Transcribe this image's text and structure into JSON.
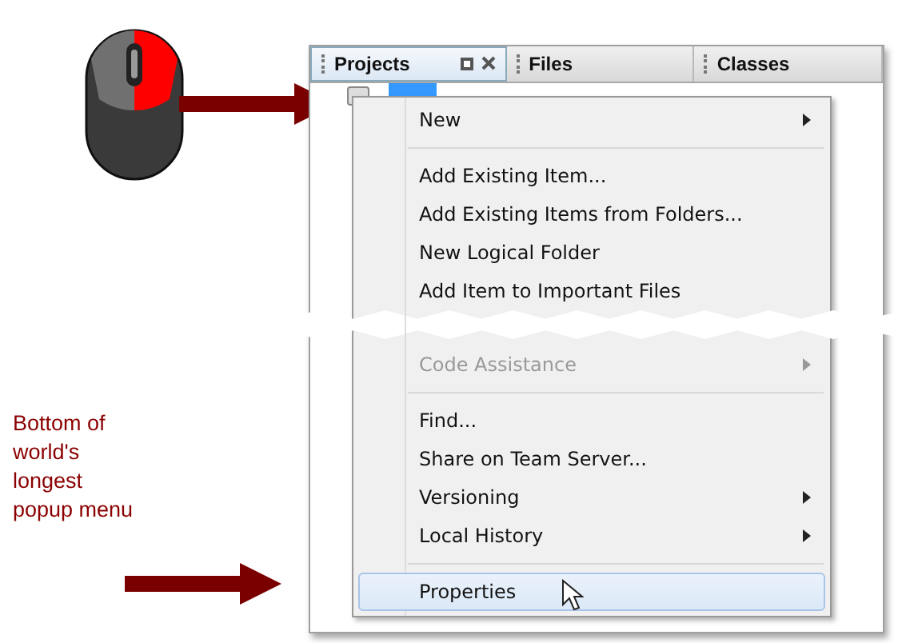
{
  "annotation": {
    "caption": "Bottom of world's longest popup menu"
  },
  "tabs": [
    {
      "label": "Projects",
      "selected": true
    },
    {
      "label": "Files",
      "selected": false
    },
    {
      "label": "Classes",
      "selected": false
    }
  ],
  "menu": [
    {
      "kind": "item",
      "label": "New",
      "submenu": true,
      "disabled": false,
      "selected": false
    },
    {
      "kind": "separator"
    },
    {
      "kind": "item",
      "label": "Add Existing Item...",
      "submenu": false,
      "disabled": false,
      "selected": false
    },
    {
      "kind": "item",
      "label": "Add Existing Items from Folders...",
      "submenu": false,
      "disabled": false,
      "selected": false
    },
    {
      "kind": "item",
      "label": "New Logical Folder",
      "submenu": false,
      "disabled": false,
      "selected": false
    },
    {
      "kind": "item",
      "label": "Add Item to Important Files",
      "submenu": false,
      "disabled": false,
      "selected": false
    },
    {
      "kind": "tear"
    },
    {
      "kind": "item",
      "label": "Code Assistance",
      "submenu": true,
      "disabled": true,
      "selected": false
    },
    {
      "kind": "separator"
    },
    {
      "kind": "item",
      "label": "Find...",
      "submenu": false,
      "disabled": false,
      "selected": false
    },
    {
      "kind": "item",
      "label": "Share on Team Server...",
      "submenu": false,
      "disabled": false,
      "selected": false
    },
    {
      "kind": "item",
      "label": "Versioning",
      "submenu": true,
      "disabled": false,
      "selected": false
    },
    {
      "kind": "item",
      "label": "Local History",
      "submenu": true,
      "disabled": false,
      "selected": false
    },
    {
      "kind": "separator"
    },
    {
      "kind": "item",
      "label": "Properties",
      "submenu": false,
      "disabled": false,
      "selected": true
    }
  ]
}
